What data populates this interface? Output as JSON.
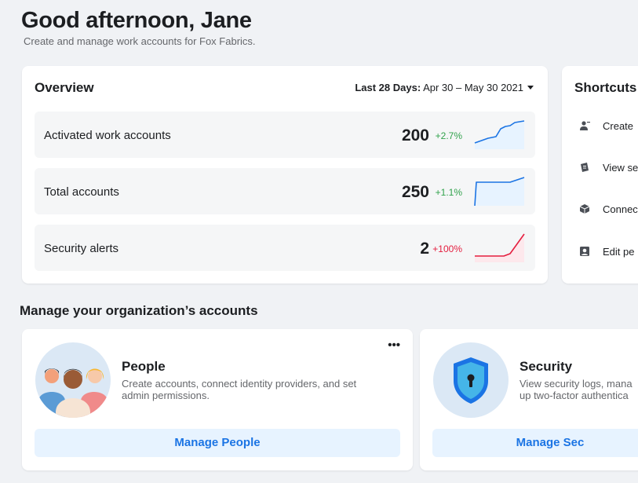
{
  "header": {
    "greeting": "Good afternoon, Jane",
    "subtitle": "Create and manage work accounts for Fox Fabrics."
  },
  "overview": {
    "title": "Overview",
    "range_key": "Last 28 Days:",
    "range_value": "Apr 30 – May 30 2021",
    "metrics": [
      {
        "label": "Activated work accounts",
        "value": "200",
        "change": "+2.7%",
        "trend": "up",
        "color": "#1b74e4"
      },
      {
        "label": "Total accounts",
        "value": "250",
        "change": "+1.1%",
        "trend": "up",
        "color": "#1b74e4"
      },
      {
        "label": "Security alerts",
        "value": "2",
        "change": "+100%",
        "trend": "up",
        "color": "#e41e3f"
      }
    ]
  },
  "shortcuts": {
    "title": "Shortcuts",
    "items": [
      {
        "label": "Create",
        "icon": "add-person-icon"
      },
      {
        "label": "View se",
        "icon": "security-log-icon"
      },
      {
        "label": "Connec",
        "icon": "cube-icon"
      },
      {
        "label": "Edit pe",
        "icon": "profile-icon"
      }
    ]
  },
  "manage": {
    "title": "Manage your organization’s accounts",
    "people": {
      "title": "People",
      "desc_line1": "Create accounts, connect identity providers, and set",
      "desc_line2": "admin permissions.",
      "button": "Manage People",
      "more": "•••",
      "icon": "people-group-icon"
    },
    "security": {
      "title": "Security",
      "desc_line1": "View security logs, mana",
      "desc_line2": "up two-factor authentica",
      "button": "Manage Sec",
      "icon": "shield-keyhole-icon"
    }
  },
  "colors": {
    "accent": "#1b74e4",
    "positive": "#31a24c",
    "negative": "#e41e3f",
    "background": "#f0f2f5"
  }
}
